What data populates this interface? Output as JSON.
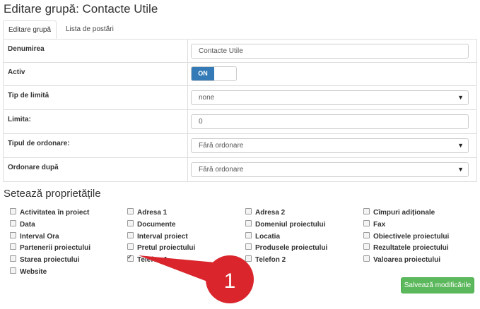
{
  "page_title": "Editare grupă: Contacte Utile",
  "tabs": [
    {
      "label": "Editare grupă",
      "active": true
    },
    {
      "label": "Lista de postări",
      "active": false
    }
  ],
  "form": {
    "rows": [
      {
        "label": "Denumirea",
        "type": "text",
        "value": "Contacte Utile"
      },
      {
        "label": "Activ",
        "type": "toggle",
        "value": "ON"
      },
      {
        "label": "Tip de limită",
        "type": "select",
        "value": "none"
      },
      {
        "label": "Limita:",
        "type": "text",
        "value": "0"
      },
      {
        "label": "Tipul de ordonare:",
        "type": "select",
        "value": "Fără ordonare"
      },
      {
        "label": "Ordonare după",
        "type": "select",
        "value": "Fără ordonare"
      }
    ]
  },
  "properties_title": "Setează proprietățile",
  "properties": [
    {
      "label": "Activitatea în proiect",
      "checked": false
    },
    {
      "label": "Adresa 1",
      "checked": false
    },
    {
      "label": "Adresa 2",
      "checked": false
    },
    {
      "label": "Cîmpuri adiționale",
      "checked": false
    },
    {
      "label": "Data",
      "checked": false
    },
    {
      "label": "Documente",
      "checked": false
    },
    {
      "label": "Domeniul proiectului",
      "checked": false
    },
    {
      "label": "Fax",
      "checked": false
    },
    {
      "label": "Interval Ora",
      "checked": false
    },
    {
      "label": "Interval proiect",
      "checked": false
    },
    {
      "label": "Locatia",
      "checked": false
    },
    {
      "label": "Obiectivele proiectului",
      "checked": false
    },
    {
      "label": "Partenerii proiectului",
      "checked": false
    },
    {
      "label": "Pretul proiectului",
      "checked": false
    },
    {
      "label": "Produsele proiectului",
      "checked": false
    },
    {
      "label": "Rezultatele proiectului",
      "checked": false
    },
    {
      "label": "Starea proiectului",
      "checked": false
    },
    {
      "label": "Telefon 1",
      "checked": true
    },
    {
      "label": "Telefon 2",
      "checked": false
    },
    {
      "label": "Valoarea proiectului",
      "checked": false
    },
    {
      "label": "Website",
      "checked": false
    }
  ],
  "save_label": "Salvează modificările",
  "callout": {
    "number": "1",
    "color": "#d9252b"
  },
  "colors": {
    "primary": "#337ab7",
    "success": "#5cb85c",
    "callout": "#d9252b"
  }
}
